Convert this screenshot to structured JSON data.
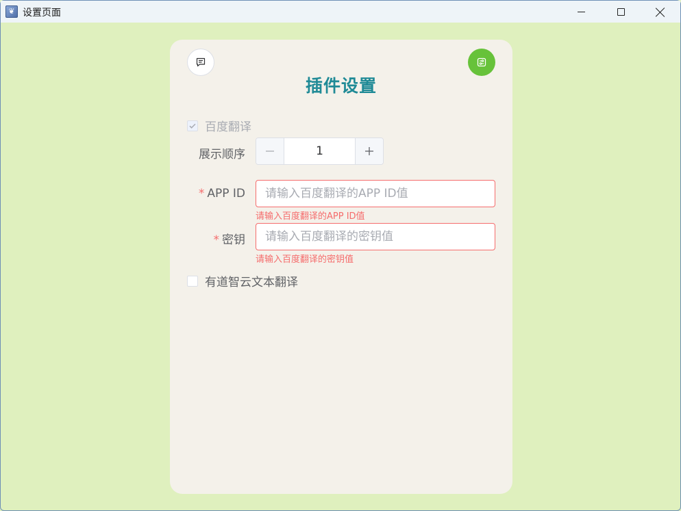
{
  "window": {
    "title": "设置页面",
    "icon": "app-icon"
  },
  "card": {
    "title": "插件设置"
  },
  "baidu": {
    "label": "百度翻译",
    "checked": true,
    "disabled": true
  },
  "order": {
    "label": "展示顺序",
    "value": "1"
  },
  "app_id": {
    "required_mark": "*",
    "label": "APP ID",
    "placeholder": "请输入百度翻译的APP ID值",
    "value": "",
    "error": "请输入百度翻译的APP ID值"
  },
  "secret": {
    "required_mark": "*",
    "label": "密钥",
    "placeholder": "请输入百度翻译的密钥值",
    "value": "",
    "error": "请输入百度翻译的密钥值"
  },
  "youdao": {
    "label": "有道智云文本翻译",
    "checked": false
  },
  "colors": {
    "background": "#dff0be",
    "card": "#f4f1ea",
    "title": "#1f8a96",
    "accent_green": "#67c23a",
    "error": "#f56c6c"
  },
  "icons": {
    "chat": "chat-icon",
    "settings": "settings-icon",
    "minimize": "minimize-icon",
    "maximize": "maximize-icon",
    "close": "close-icon",
    "check": "check-icon",
    "minus": "minus-icon",
    "plus": "plus-icon"
  }
}
